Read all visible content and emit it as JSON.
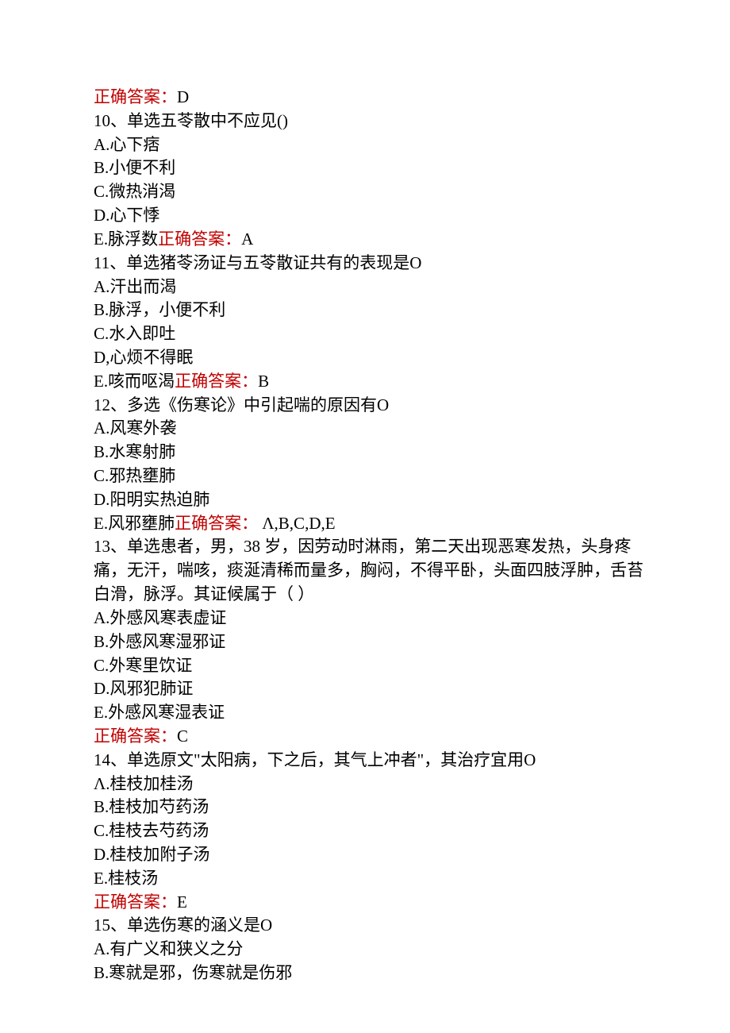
{
  "lines": [
    {
      "segments": [
        {
          "text": "正确答案：",
          "red": true
        },
        {
          "text": "D"
        }
      ]
    },
    {
      "segments": [
        {
          "text": "10、单选五苓散中不应见()"
        }
      ]
    },
    {
      "segments": [
        {
          "text": "A.心下痞"
        }
      ]
    },
    {
      "segments": [
        {
          "text": "B.小便不利"
        }
      ]
    },
    {
      "segments": [
        {
          "text": "C.微热消渴"
        }
      ]
    },
    {
      "segments": [
        {
          "text": "D.心下悸"
        }
      ]
    },
    {
      "segments": [
        {
          "text": "E.脉浮数"
        },
        {
          "text": "正确答案：",
          "red": true
        },
        {
          "text": "A"
        }
      ]
    },
    {
      "segments": [
        {
          "text": "11、单选猪苓汤证与五苓散证共有的表现是O"
        }
      ]
    },
    {
      "segments": [
        {
          "text": "A.汗出而渴"
        }
      ]
    },
    {
      "segments": [
        {
          "text": "B.脉浮，小便不利"
        }
      ]
    },
    {
      "segments": [
        {
          "text": "C.水入即吐"
        }
      ]
    },
    {
      "segments": [
        {
          "text": "D,心烦不得眠"
        }
      ]
    },
    {
      "segments": [
        {
          "text": "E.咳而呕渴"
        },
        {
          "text": "正确答案：",
          "red": true
        },
        {
          "text": "B"
        }
      ]
    },
    {
      "segments": [
        {
          "text": "12、多选《伤寒论》中引起喘的原因有O"
        }
      ]
    },
    {
      "segments": [
        {
          "text": "A.风寒外袭"
        }
      ]
    },
    {
      "segments": [
        {
          "text": "B.水寒射肺"
        }
      ]
    },
    {
      "segments": [
        {
          "text": "C.邪热壅肺"
        }
      ]
    },
    {
      "segments": [
        {
          "text": "D.阳明实热迫肺"
        }
      ]
    },
    {
      "segments": [
        {
          "text": "E.风邪壅肺"
        },
        {
          "text": "正确答案：",
          "red": true
        },
        {
          "text": " Λ,B,C,D,E"
        }
      ]
    },
    {
      "segments": [
        {
          "text": "13、单选患者，男，38 岁，因劳动时淋雨，第二天出现恶寒发热，头身疼痛，无汗，喘咳，痰涎清稀而量多，胸闷，不得平卧，头面四肢浮肿，舌苔白滑，脉浮。其证候属于（ ）"
        }
      ]
    },
    {
      "segments": [
        {
          "text": "A.外感风寒表虚证"
        }
      ]
    },
    {
      "segments": [
        {
          "text": "B.外感风寒湿邪证"
        }
      ]
    },
    {
      "segments": [
        {
          "text": "C.外寒里饮证"
        }
      ]
    },
    {
      "segments": [
        {
          "text": "D.风邪犯肺证"
        }
      ]
    },
    {
      "segments": [
        {
          "text": "E.外感风寒湿表证"
        }
      ]
    },
    {
      "segments": [
        {
          "text": "正确答案：",
          "red": true
        },
        {
          "text": "C"
        }
      ]
    },
    {
      "segments": [
        {
          "text": "14、单选原文\"太阳病，下之后，其气上冲者\"，其治疗宜用O"
        }
      ]
    },
    {
      "segments": [
        {
          "text": "Λ.桂枝加桂汤"
        }
      ]
    },
    {
      "segments": [
        {
          "text": "B.桂枝加芍药汤"
        }
      ]
    },
    {
      "segments": [
        {
          "text": "C.桂枝去芍药汤"
        }
      ]
    },
    {
      "segments": [
        {
          "text": "D.桂枝加附子汤"
        }
      ]
    },
    {
      "segments": [
        {
          "text": "E.桂枝汤"
        }
      ]
    },
    {
      "segments": [
        {
          "text": "正确答案：",
          "red": true
        },
        {
          "text": "E"
        }
      ]
    },
    {
      "segments": [
        {
          "text": "15、单选伤寒的涵义是O"
        }
      ]
    },
    {
      "segments": [
        {
          "text": "A.有广义和狭义之分"
        }
      ]
    },
    {
      "segments": [
        {
          "text": "B.寒就是邪，伤寒就是伤邪"
        }
      ]
    }
  ]
}
